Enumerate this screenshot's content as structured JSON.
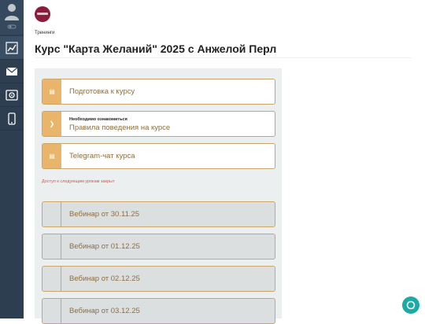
{
  "sidebar": {
    "items": [
      {
        "icon": "chart-icon",
        "active": true
      },
      {
        "icon": "mail-icon",
        "active": false
      },
      {
        "icon": "safe-icon",
        "active": false
      },
      {
        "icon": "phone-icon",
        "active": false
      }
    ]
  },
  "header": {
    "breadcrumb": "Тренинги",
    "title": "Курс \"Карта Желаний\" 2025 с Анжелой Перл"
  },
  "lessons": {
    "open": [
      {
        "label": "Подготовка к курсу",
        "icon": "document-icon"
      },
      {
        "sublabel": "Необходимо ознакомиться",
        "label": "Правила поведения на курсе",
        "icon": "chevron-right-icon"
      },
      {
        "label": "Telegram-чат курса",
        "icon": "document-icon"
      }
    ],
    "locked_message": "Доступ к следующим урокам закрыт",
    "locked": [
      {
        "label": "Вебинар от 30.11.25"
      },
      {
        "label": "Вебинар от 01.12.25"
      },
      {
        "label": "Вебинар от 02.12.25"
      },
      {
        "label": "Вебинар от 03.12.25"
      }
    ]
  },
  "colors": {
    "sidebar_bg": "#2c3e50",
    "accent_gold": "#c9a66b",
    "tab_orange": "#e8b56a",
    "locked_text": "#d9534f",
    "chat_button": "#1aaba8"
  }
}
